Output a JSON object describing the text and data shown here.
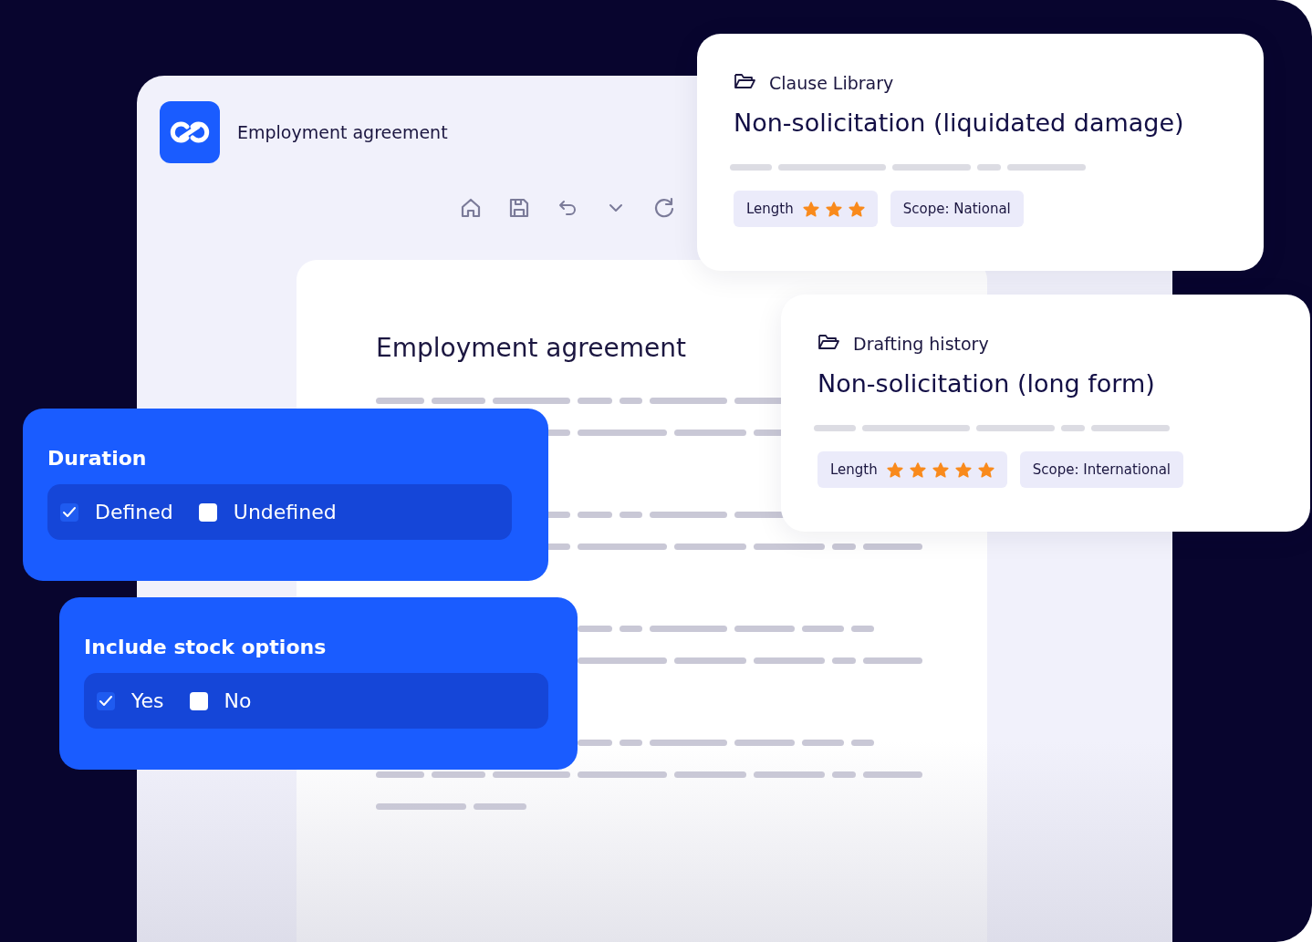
{
  "app": {
    "title": "Employment agreement"
  },
  "document": {
    "heading": "Employment agreement"
  },
  "clause_cards": [
    {
      "source": "Clause Library",
      "title": "Non-solicitation (liquidated damage)",
      "length_label": "Length",
      "stars": 3,
      "scope": "Scope: National"
    },
    {
      "source": "Drafting history",
      "title": "Non-solicitation (long form)",
      "length_label": "Length",
      "stars": 5,
      "scope": "Scope: International"
    }
  ],
  "option_panels": [
    {
      "title": "Duration",
      "options": [
        {
          "label": "Defined",
          "checked": true
        },
        {
          "label": "Undefined",
          "checked": false
        }
      ]
    },
    {
      "title": "Include stock options",
      "options": [
        {
          "label": "Yes",
          "checked": true
        },
        {
          "label": "No",
          "checked": false
        }
      ]
    }
  ]
}
